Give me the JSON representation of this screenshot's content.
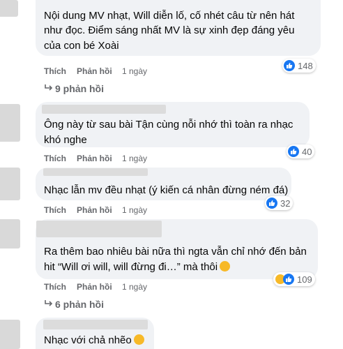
{
  "comments": [
    {
      "text_lines": [
        "Nội dung MV nhạt, Will diễn lố, cố nhét câu từ nên hát",
        "như đọc. Điểm sáng nhất MV là sự xinh đẹp đáng yêu",
        "của con bé Xoài"
      ],
      "like_label": "Thích",
      "reply_label": "Phản hồi",
      "time": "1 ngày",
      "reaction_count": "148",
      "replies_label": "9 phản hồi"
    },
    {
      "text_lines": [
        "Ông này từ sau bài Tận cùng nỗi nhớ thì toàn ra nhạc",
        "khó nghe"
      ],
      "like_label": "Thích",
      "reply_label": "Phản hồi",
      "time": "1 ngày",
      "reaction_count": "40"
    },
    {
      "text_lines": [
        "Nhạc lẫn mv đều nhạt (ý kiến cá nhân đừng ném đá)"
      ],
      "like_label": "Thích",
      "reply_label": "Phản hồi",
      "time": "1 ngày",
      "reaction_count": "32"
    },
    {
      "text_lines": [
        "Ra thêm bao nhiêu bài nữa thì ngta vẫn chỉ nhớ đến bản",
        "hit “Will ơi will, will đừng đi…” mà thôi"
      ],
      "like_label": "Thích",
      "reply_label": "Phản hồi",
      "time": "1 ngày",
      "reaction_count": "109",
      "replies_label": "6 phản hồi"
    },
    {
      "text_lines": [
        "Nhạc với chả nhẽo"
      ]
    }
  ],
  "colors": {
    "bubble": "#f0f2f5",
    "meta_text": "#65676b",
    "like_blue": "#1877f2",
    "emoji_yellow": "#f7b928"
  },
  "icons": {
    "like": "thumbs-up-icon",
    "haha": "haha-emoji-icon",
    "reply_arrow": "reply-arrow-icon"
  }
}
